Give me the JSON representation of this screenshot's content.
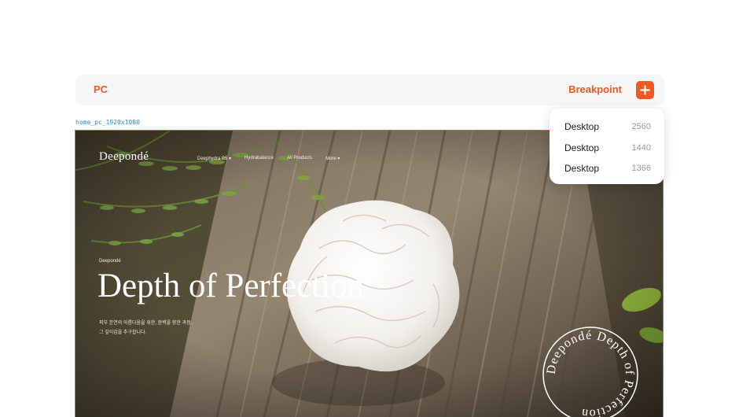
{
  "toolbar": {
    "left_label": "PC",
    "right_label": "Breakpoint",
    "add_icon": "plus-icon",
    "accent_color": "#f2581f"
  },
  "frame": {
    "label": "home_pc_1920x1080",
    "outline_color": "#2f97f0"
  },
  "site": {
    "logo": "Deepondé",
    "nav": [
      "Deephydra B5 ▾",
      "Hydrabalance",
      "All Products",
      "More ▾"
    ],
    "hero": {
      "eyebrow": "Deepondé",
      "title": "Depth of Perfection",
      "desc_line1": "피부 본연의 아름다움을 위한, 완벽을 향한 과정.",
      "desc_line2": "그 깊이감을 추구합니다."
    },
    "badge_text": "Deepondé Depth of Perfection"
  },
  "breakpoints": [
    {
      "name": "Desktop",
      "width": "2560"
    },
    {
      "name": "Desktop",
      "width": "1440"
    },
    {
      "name": "Desktop",
      "width": "1366"
    }
  ]
}
